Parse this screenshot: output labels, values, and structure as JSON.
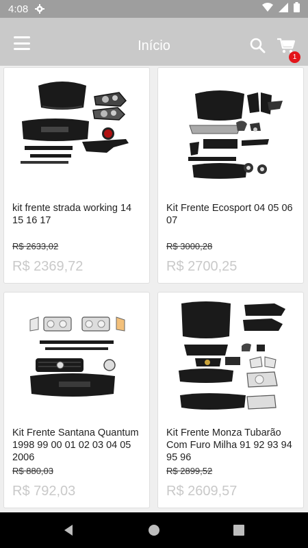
{
  "status_bar": {
    "time": "4:08"
  },
  "app_bar": {
    "title": "Início",
    "cart_count": "1"
  },
  "products": [
    {
      "name": "kit frente strada working 14 15 16 17",
      "old_price": "R$ 2633,02",
      "price": "R$ 2369,72"
    },
    {
      "name": "Kit Frente Ecosport 04 05 06 07",
      "old_price": "R$ 3000,28",
      "price": "R$ 2700,25"
    },
    {
      "name": "Kit Frente Santana  Quantum 1998 99 00 01 02 03 04 05 2006",
      "old_price": "R$ 880,03",
      "price": "R$ 792,03"
    },
    {
      "name": "Kit Frente Monza Tubarão Com Furo Milha 91 92 93 94 95 96",
      "old_price": "R$ 2899,52",
      "price": "R$ 2609,57"
    }
  ],
  "icons": {
    "status": [
      "gear-icon",
      "wifi-icon",
      "signal-icon",
      "battery-icon"
    ],
    "app_bar": [
      "menu-icon",
      "search-icon",
      "cart-icon"
    ],
    "nav": [
      "back-icon",
      "home-icon",
      "recents-icon"
    ]
  },
  "colors": {
    "app_bar": "#c9c9c9",
    "status_bar": "#9e9e9e",
    "badge": "#e3151b",
    "price": "#c9c9c9",
    "part_black": "#1a1a1a"
  }
}
